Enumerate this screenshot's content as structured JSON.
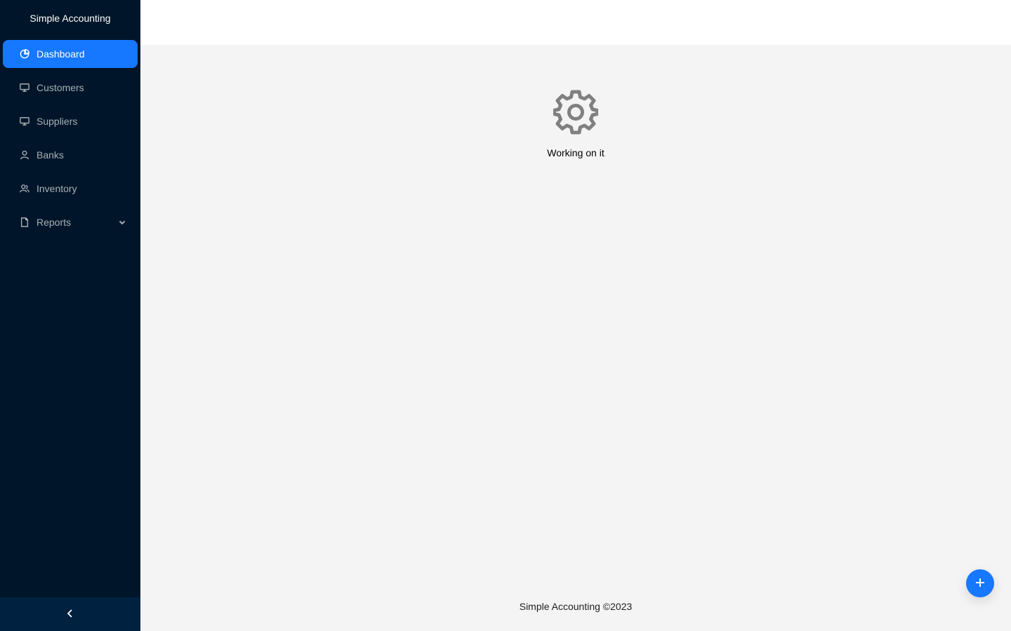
{
  "app": {
    "title": "Simple Accounting"
  },
  "sidebar": {
    "items": [
      {
        "label": "Dashboard",
        "icon": "pie-chart-icon"
      },
      {
        "label": "Customers",
        "icon": "desktop-icon"
      },
      {
        "label": "Suppliers",
        "icon": "desktop-icon"
      },
      {
        "label": "Banks",
        "icon": "user-icon"
      },
      {
        "label": "Inventory",
        "icon": "team-icon"
      },
      {
        "label": "Reports",
        "icon": "file-icon"
      }
    ],
    "active": "Dashboard",
    "collapse_icon": "chevron-left-icon"
  },
  "main": {
    "status_icon": "gear-icon",
    "status_text": "Working on it"
  },
  "footer": {
    "text": "Simple Accounting ©2023"
  },
  "fab": {
    "icon": "plus-icon"
  },
  "colors": {
    "sidebar_bg": "#001529",
    "accent": "#1677ff",
    "content_bg": "#f4f4f4",
    "gear": "#808080"
  }
}
